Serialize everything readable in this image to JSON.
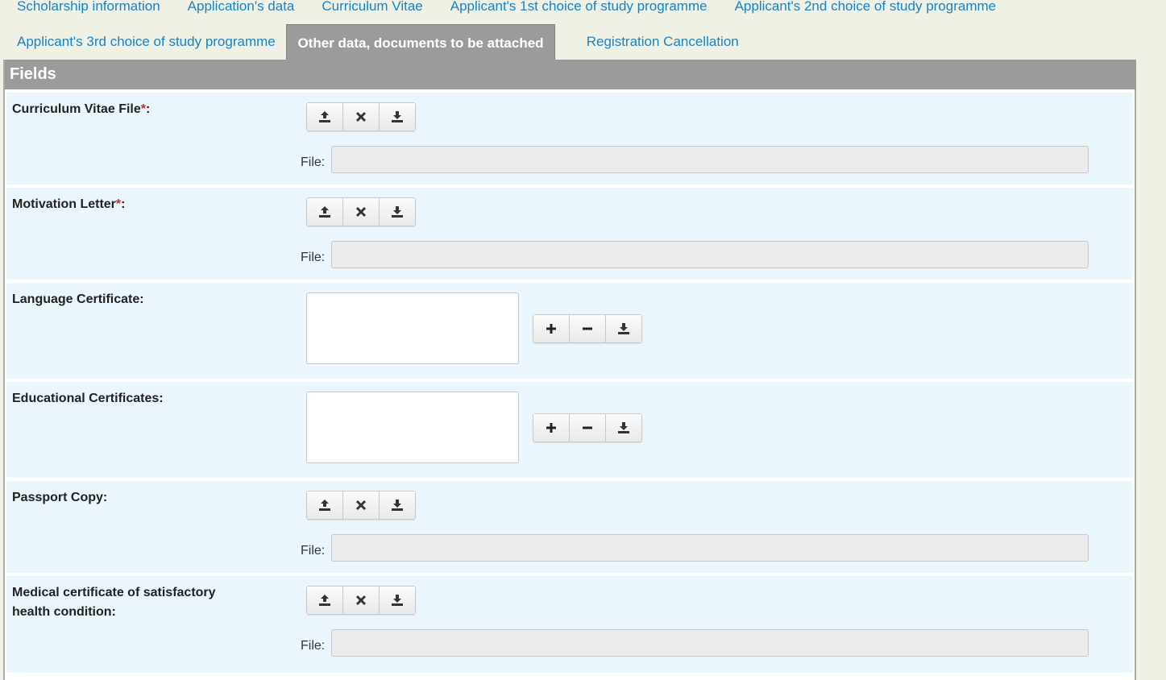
{
  "tabs": [
    {
      "label": "Scholarship information"
    },
    {
      "label": "Application's data"
    },
    {
      "label": "Curriculum Vitae"
    },
    {
      "label": "Applicant's 1st choice of study programme"
    },
    {
      "label": "Applicant's 2nd choice of study programme"
    },
    {
      "label": "Applicant's 3rd choice of study programme"
    },
    {
      "label": "Other data, documents to be attached",
      "active": true
    },
    {
      "label": "Registration Cancellation"
    }
  ],
  "panel": {
    "header": "Fields",
    "required_marker": "*",
    "file_label": "File:",
    "fields": [
      {
        "label": "Curriculum Vitae File",
        "required": true,
        "suffix": ":",
        "type": "file",
        "value": ""
      },
      {
        "label": "Motivation Letter",
        "required": true,
        "suffix": ":",
        "type": "file",
        "value": ""
      },
      {
        "label": "Language Certificate:",
        "required": false,
        "type": "list",
        "items": []
      },
      {
        "label": "Educational Certificates:",
        "required": false,
        "type": "list",
        "items": []
      },
      {
        "label": "Passport Copy:",
        "required": false,
        "type": "file",
        "value": ""
      },
      {
        "label": "Medical certificate of satisfactory health condition:",
        "required": false,
        "type": "file",
        "value": ""
      }
    ]
  },
  "icons": {
    "upload": "upload-icon",
    "remove": "remove-icon",
    "download": "download-icon",
    "add": "plus-icon",
    "minus": "minus-icon"
  },
  "colors": {
    "tab_link": "#1a83c4",
    "active_tab_bg": "#9b9b9b",
    "row_bg": "#eaf6fb",
    "required": "#e0261b",
    "page_bg": "#eff1e4"
  }
}
